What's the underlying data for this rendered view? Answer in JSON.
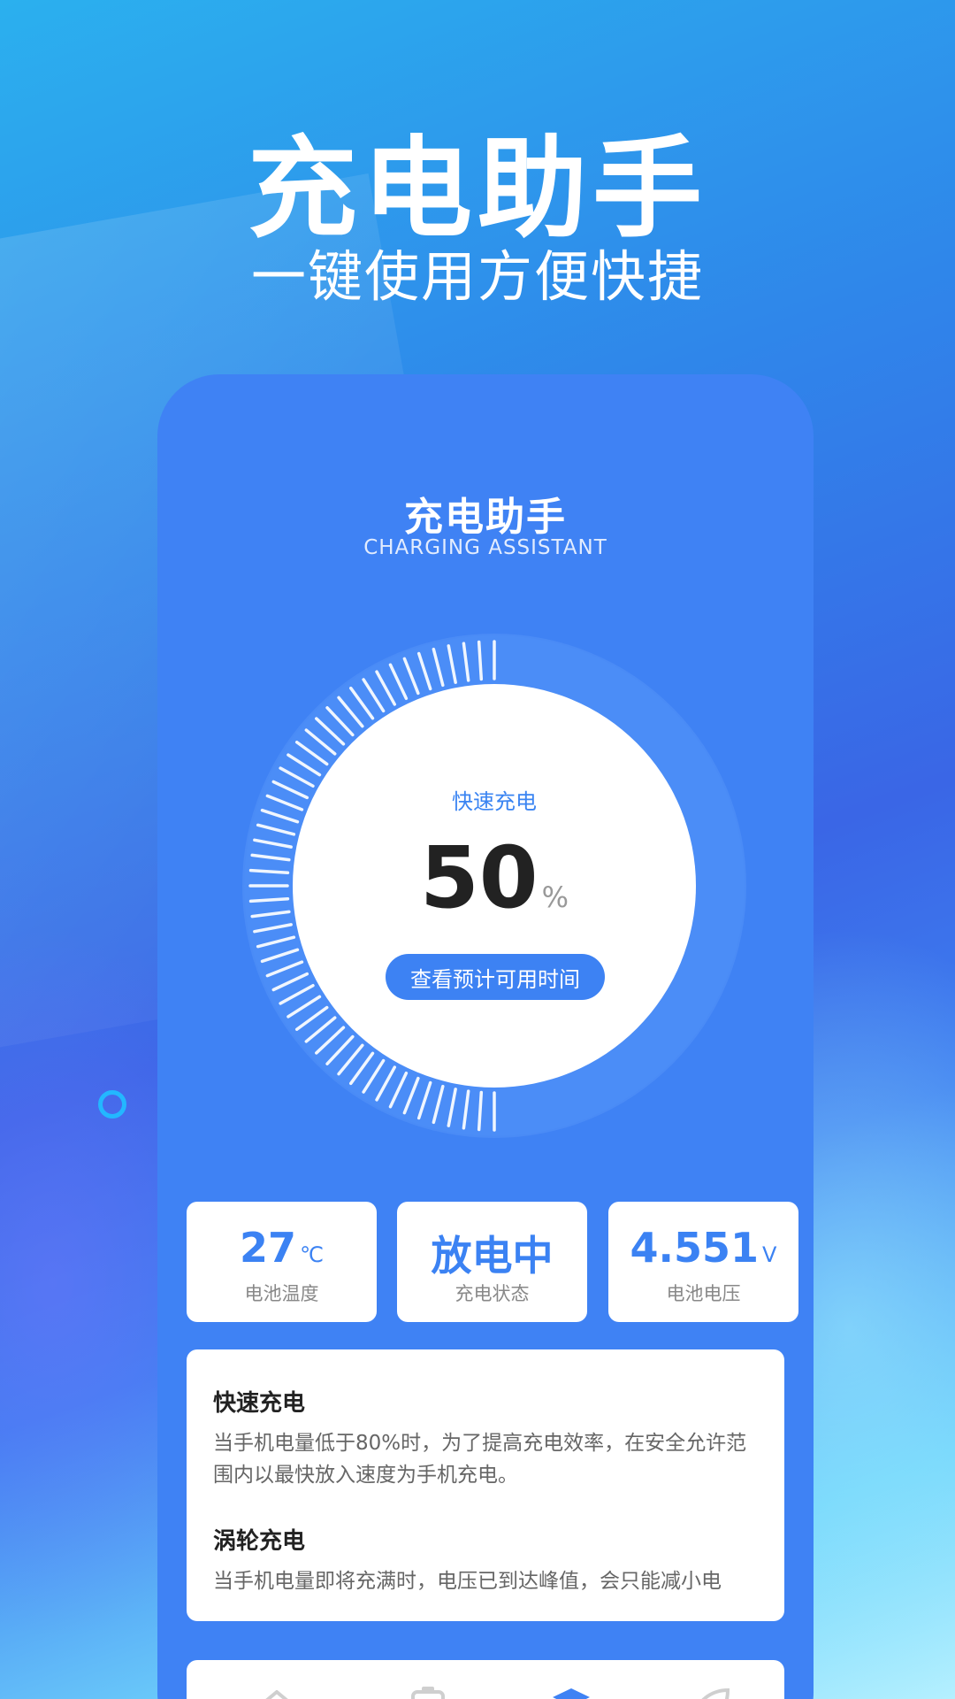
{
  "hero": {
    "title": "充电助手",
    "subtitle": "一键使用方便快捷"
  },
  "app": {
    "title": "充电助手",
    "subtitle": "CHARGING ASSISTANT",
    "gauge": {
      "mode": "快速充电",
      "percent": "50",
      "unit": "%",
      "button": "查看预计可用时间"
    },
    "stats": [
      {
        "value": "27",
        "unit": "℃",
        "label": "电池温度"
      },
      {
        "value": "放电中",
        "unit": "",
        "label": "充电状态"
      },
      {
        "value": "4.551",
        "unit": "V",
        "label": "电池电压"
      }
    ],
    "info": [
      {
        "title": "快速充电",
        "text": "当手机电量低于80%时，为了提高充电效率，在安全允许范围内以最快放入速度为手机充电。"
      },
      {
        "title": "涡轮充电",
        "text": "当手机电量即将充满时，电压已到达峰值，会只能减小电"
      }
    ],
    "nav": [
      {
        "icon": "home-icon"
      },
      {
        "icon": "battery-icon"
      },
      {
        "icon": "box-icon"
      },
      {
        "icon": "leaf-icon"
      }
    ]
  },
  "colors": {
    "primary": "#3f82f4",
    "accent": "#3a84f2"
  }
}
